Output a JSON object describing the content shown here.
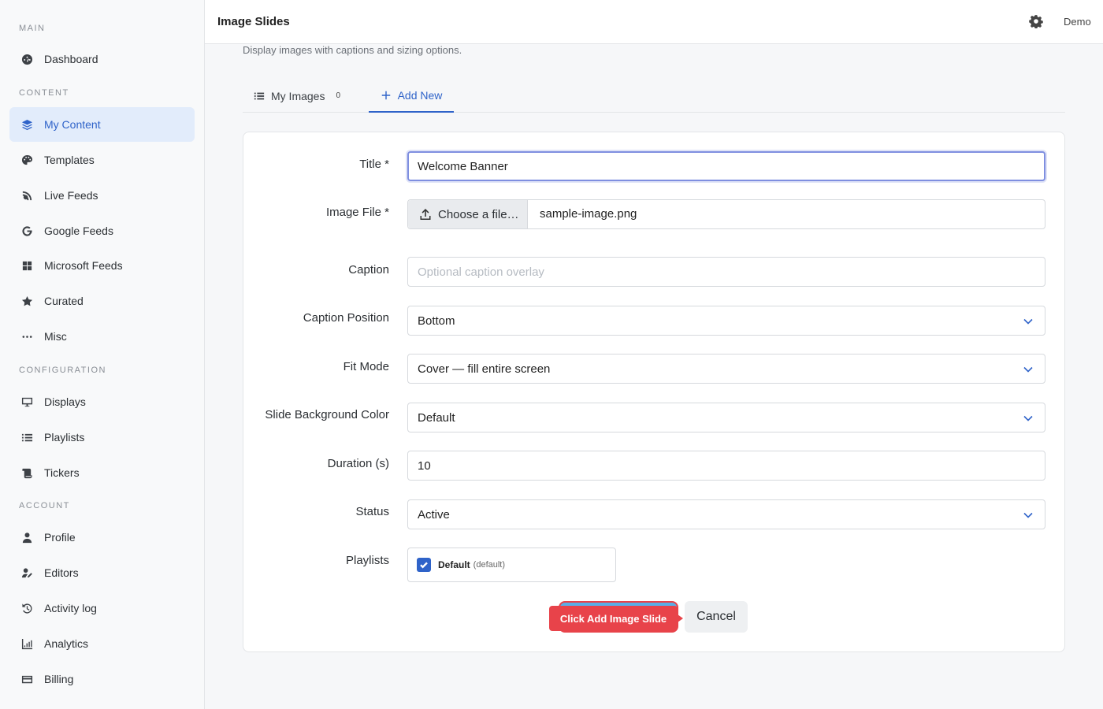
{
  "sidebar": {
    "sections": [
      {
        "label": "MAIN"
      },
      {
        "label": "CONTENT"
      },
      {
        "label": "CONFIGURATION"
      },
      {
        "label": "ACCOUNT"
      }
    ],
    "items": [
      {
        "label": "Dashboard",
        "icon": "dashboard-icon"
      },
      {
        "label": "My Content",
        "icon": "layers-icon",
        "active": true
      },
      {
        "label": "Templates",
        "icon": "palette-icon"
      },
      {
        "label": "Live Feeds",
        "icon": "satellite-dish-icon"
      },
      {
        "label": "Google Feeds",
        "icon": "google-icon"
      },
      {
        "label": "Microsoft Feeds",
        "icon": "windows-icon"
      },
      {
        "label": "Curated",
        "icon": "star-icon"
      },
      {
        "label": "Misc",
        "icon": "ellipsis-icon"
      },
      {
        "label": "Displays",
        "icon": "monitor-icon"
      },
      {
        "label": "Playlists",
        "icon": "list-icon"
      },
      {
        "label": "Tickers",
        "icon": "scroll-icon"
      },
      {
        "label": "Profile",
        "icon": "user-icon"
      },
      {
        "label": "Editors",
        "icon": "user-edit-icon"
      },
      {
        "label": "Activity log",
        "icon": "history-icon"
      },
      {
        "label": "Analytics",
        "icon": "chart-line-icon"
      },
      {
        "label": "Billing",
        "icon": "credit-card-icon"
      }
    ]
  },
  "header": {
    "title": "Image Slides",
    "user": "Demo",
    "settings_icon": "gear-icon"
  },
  "page": {
    "subtitle": "Display images with captions and sizing options."
  },
  "tabs": {
    "list_label": "My Images",
    "list_count": "0",
    "add_label": "Add New"
  },
  "form": {
    "title_label": "Title *",
    "title_value": "Welcome Banner",
    "file_label": "Image File *",
    "file_button": "Choose a file…",
    "file_name": "sample-image.png",
    "caption_label": "Caption",
    "caption_placeholder": "Optional caption overlay",
    "caption_position_label": "Caption Position",
    "caption_position_value": "Bottom",
    "fit_label": "Fit Mode",
    "fit_value": "Cover — fill entire screen",
    "bg_label": "Slide Background Color",
    "bg_value": "Default",
    "duration_label": "Duration (s)",
    "duration_value": "10",
    "status_label": "Status",
    "status_value": "Active",
    "playlists_label": "Playlists",
    "playlist_name": "Default",
    "playlist_note": "(default)",
    "playlist_checked": true,
    "submit_tooltip": "Click Add Image Slide",
    "cancel_label": "Cancel"
  },
  "colors": {
    "accent": "#2f63c9",
    "highlight": "#e8434a",
    "primary_button": "#5aaee6"
  }
}
